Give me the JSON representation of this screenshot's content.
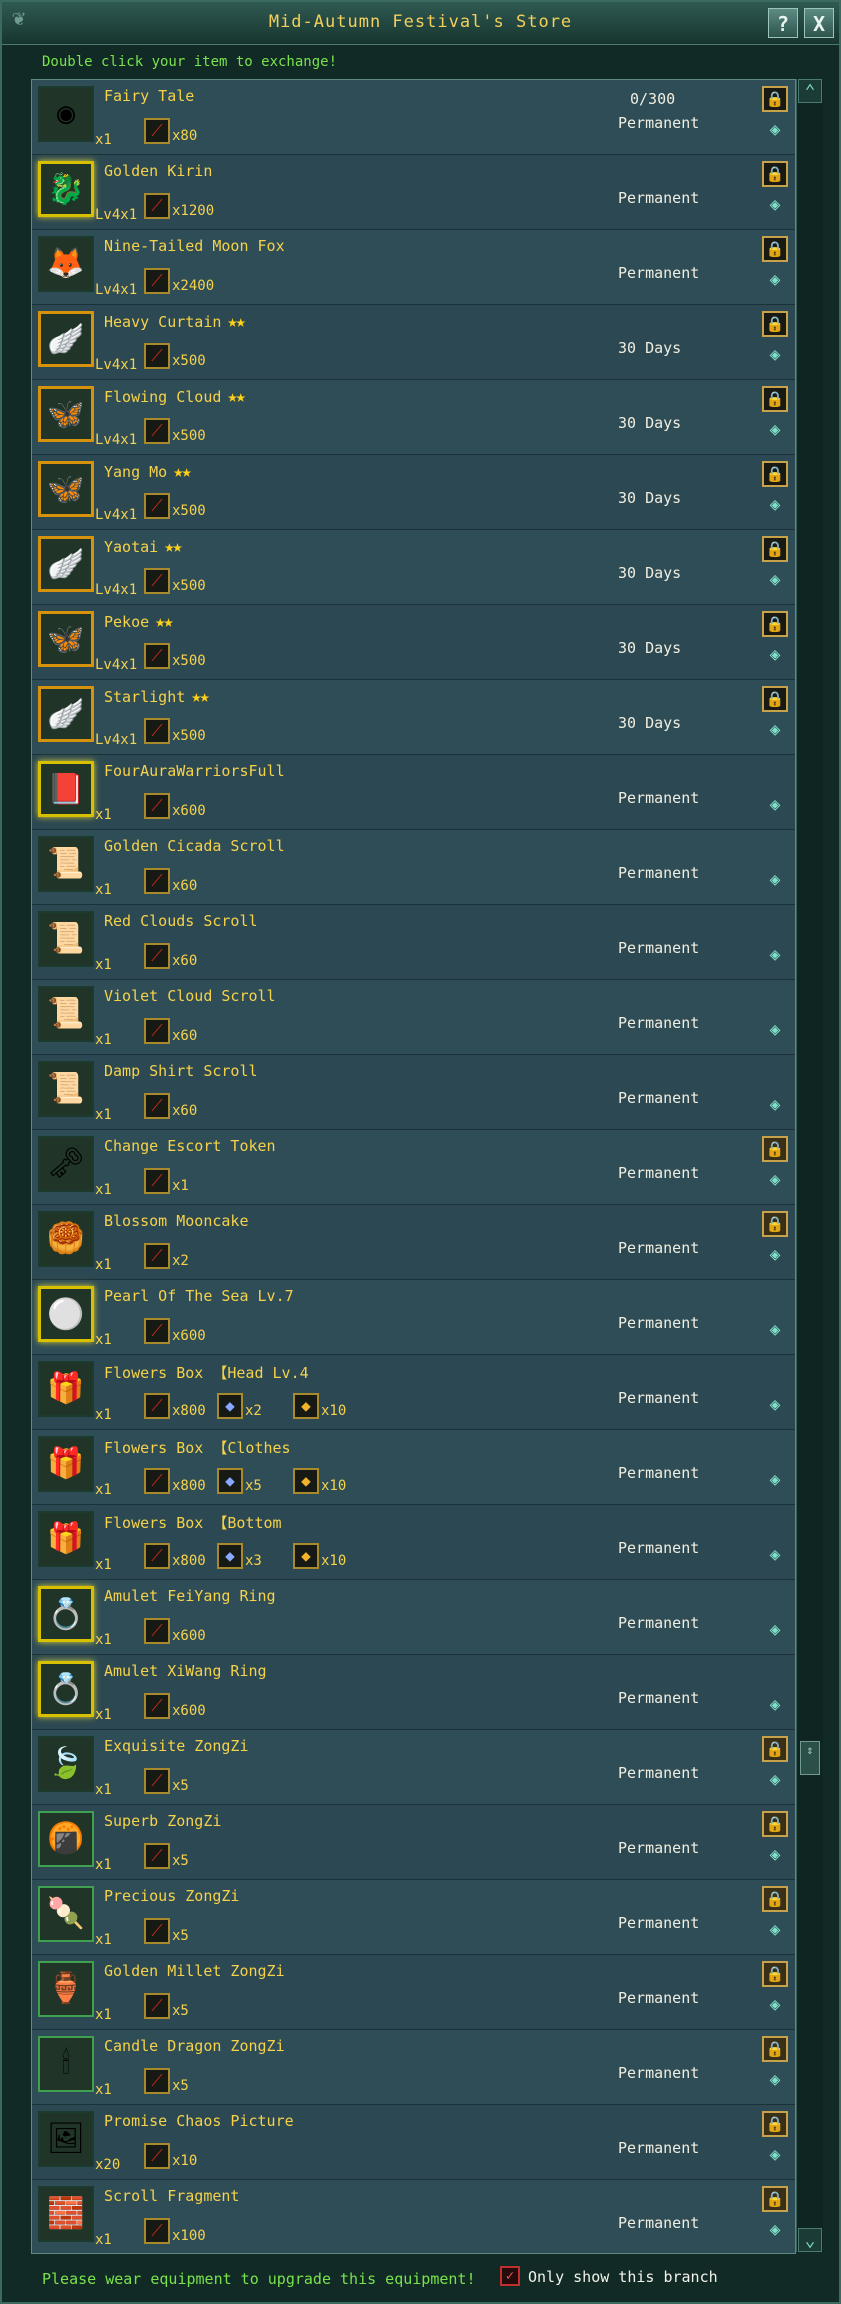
{
  "window": {
    "title": "Mid-Autumn Festival's Store",
    "help_label": "?",
    "close_label": "X"
  },
  "hint": "Double click your item to exchange!",
  "items": [
    {
      "name": "Fairy Tale",
      "qty": "x1",
      "costs": [
        "x80"
      ],
      "duration": "Permanent",
      "limit": "0/300",
      "stars": ""
    },
    {
      "name": "Golden Kirin",
      "qty": "Lv4x1",
      "costs": [
        "x1200"
      ],
      "duration": "Permanent",
      "stars": ""
    },
    {
      "name": "Nine-Tailed Moon Fox",
      "qty": "Lv4x1",
      "costs": [
        "x2400"
      ],
      "duration": "Permanent",
      "stars": ""
    },
    {
      "name": "Heavy Curtain",
      "qty": "Lv4x1",
      "costs": [
        "x500"
      ],
      "duration": "30 Days",
      "stars": "★★"
    },
    {
      "name": "Flowing Cloud",
      "qty": "Lv4x1",
      "costs": [
        "x500"
      ],
      "duration": "30 Days",
      "stars": "★★"
    },
    {
      "name": "Yang Mo",
      "qty": "Lv4x1",
      "costs": [
        "x500"
      ],
      "duration": "30 Days",
      "stars": "★★"
    },
    {
      "name": "Yaotai",
      "qty": "Lv4x1",
      "costs": [
        "x500"
      ],
      "duration": "30 Days",
      "stars": "★★"
    },
    {
      "name": "Pekoe",
      "qty": "Lv4x1",
      "costs": [
        "x500"
      ],
      "duration": "30 Days",
      "stars": "★★"
    },
    {
      "name": "Starlight",
      "qty": "Lv4x1",
      "costs": [
        "x500"
      ],
      "duration": "30 Days",
      "stars": "★★"
    },
    {
      "name": "FourAuraWarriorsFull",
      "qty": "x1",
      "costs": [
        "x600"
      ],
      "duration": "Permanent",
      "stars": ""
    },
    {
      "name": "Golden Cicada Scroll",
      "qty": "x1",
      "costs": [
        "x60"
      ],
      "duration": "Permanent",
      "stars": ""
    },
    {
      "name": "Red Clouds Scroll",
      "qty": "x1",
      "costs": [
        "x60"
      ],
      "duration": "Permanent",
      "stars": ""
    },
    {
      "name": "Violet Cloud Scroll",
      "qty": "x1",
      "costs": [
        "x60"
      ],
      "duration": "Permanent",
      "stars": ""
    },
    {
      "name": "Damp Shirt Scroll",
      "qty": "x1",
      "costs": [
        "x60"
      ],
      "duration": "Permanent",
      "stars": ""
    },
    {
      "name": "Change Escort Token",
      "qty": "x1",
      "costs": [
        "x1"
      ],
      "duration": "Permanent",
      "stars": ""
    },
    {
      "name": "Blossom Mooncake",
      "qty": "x1",
      "costs": [
        "x2"
      ],
      "duration": "Permanent",
      "stars": ""
    },
    {
      "name": "Pearl Of The Sea Lv.7",
      "qty": "x1",
      "costs": [
        "x600"
      ],
      "duration": "Permanent",
      "stars": ""
    },
    {
      "name": "Flowers Box 【Head Lv.4",
      "qty": "x1",
      "costs": [
        "x800",
        "x2",
        "x10"
      ],
      "duration": "Permanent",
      "stars": ""
    },
    {
      "name": "Flowers Box 【Clothes",
      "qty": "x1",
      "costs": [
        "x800",
        "x5",
        "x10"
      ],
      "duration": "Permanent",
      "stars": ""
    },
    {
      "name": "Flowers Box 【Bottom",
      "qty": "x1",
      "costs": [
        "x800",
        "x3",
        "x10"
      ],
      "duration": "Permanent",
      "stars": ""
    },
    {
      "name": "Amulet FeiYang Ring",
      "qty": "x1",
      "costs": [
        "x600"
      ],
      "duration": "Permanent",
      "stars": ""
    },
    {
      "name": "Amulet XiWang Ring",
      "qty": "x1",
      "costs": [
        "x600"
      ],
      "duration": "Permanent",
      "stars": ""
    },
    {
      "name": "Exquisite ZongZi",
      "qty": "x1",
      "costs": [
        "x5"
      ],
      "duration": "Permanent",
      "stars": ""
    },
    {
      "name": "Superb ZongZi",
      "qty": "x1",
      "costs": [
        "x5"
      ],
      "duration": "Permanent",
      "stars": ""
    },
    {
      "name": "Precious ZongZi",
      "qty": "x1",
      "costs": [
        "x5"
      ],
      "duration": "Permanent",
      "stars": ""
    },
    {
      "name": "Golden Millet ZongZi",
      "qty": "x1",
      "costs": [
        "x5"
      ],
      "duration": "Permanent",
      "stars": ""
    },
    {
      "name": "Candle Dragon ZongZi",
      "qty": "x1",
      "costs": [
        "x5"
      ],
      "duration": "Permanent",
      "stars": ""
    },
    {
      "name": "Promise Chaos Picture",
      "qty": "x20",
      "costs": [
        "x10"
      ],
      "duration": "Permanent",
      "stars": ""
    },
    {
      "name": "Scroll Fragment",
      "qty": "x1",
      "costs": [
        "x100"
      ],
      "duration": "Permanent",
      "stars": ""
    }
  ],
  "footer": {
    "message": "Please wear equipment to upgrade this equipment!",
    "checkbox_label": "Only show this branch",
    "checkbox_checked": true
  }
}
